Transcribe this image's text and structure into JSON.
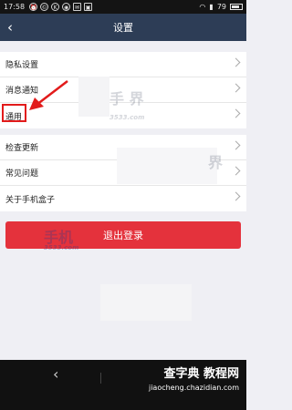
{
  "status_bar": {
    "time": "17:58",
    "icons": [
      "alarm-icon",
      "copyright-icon",
      "kaspersky-icon",
      "gamepad-icon",
      "mail-icon",
      "image-icon"
    ],
    "battery": "79",
    "battery_level": 0.79
  },
  "header": {
    "back": "‹",
    "title": "设置"
  },
  "settings": {
    "group1": [
      {
        "label": "隐私设置"
      },
      {
        "label": "消息通知"
      },
      {
        "label": "通用"
      }
    ],
    "group2": [
      {
        "label": "检查更新"
      },
      {
        "label": "常见问题"
      },
      {
        "label": "关于手机盒子"
      }
    ]
  },
  "logout": {
    "label": "退出登录"
  },
  "watermarks": {
    "a": "手   界",
    "b": "3533.com",
    "c": "界",
    "d": "手机",
    "e": "3533.com"
  },
  "bottom": {
    "nav_back": "‹",
    "brand": "查字典 教程网",
    "url": "jiaocheng.chazidian.com"
  },
  "colors": {
    "nav": "#2d3d56",
    "logout": "#e4323c",
    "highlight": "#e21b1b"
  }
}
